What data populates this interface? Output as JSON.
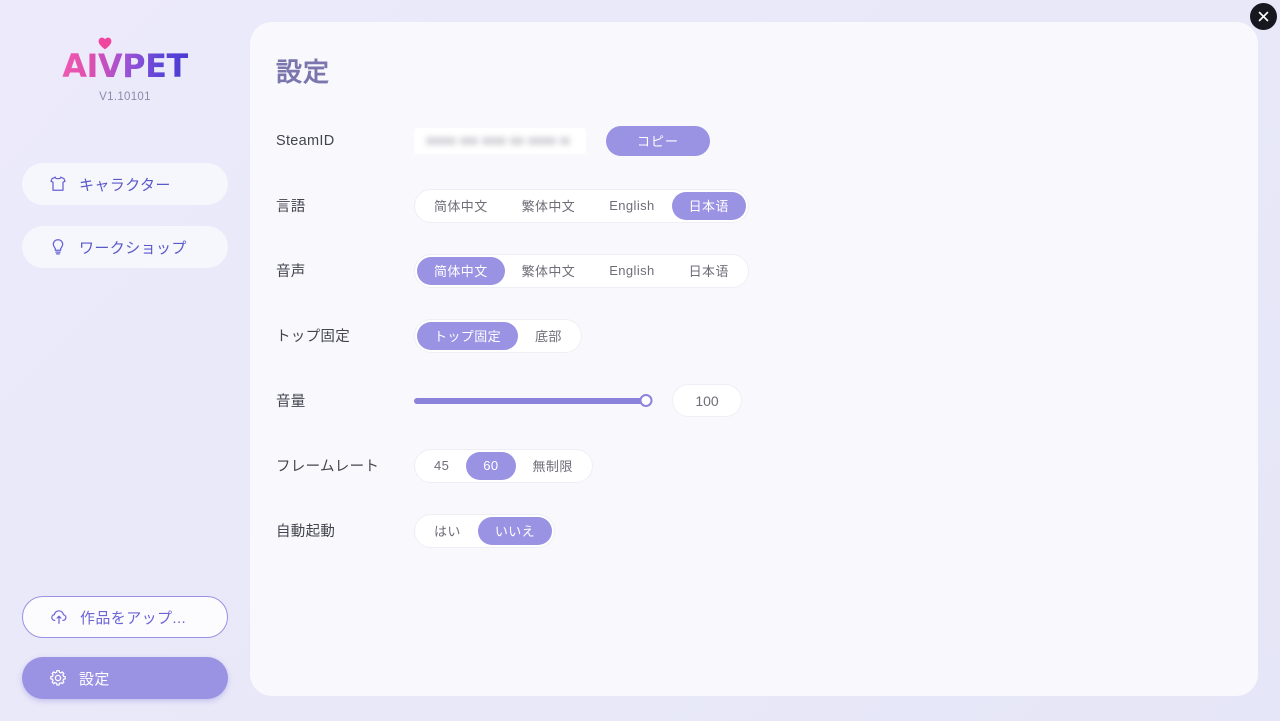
{
  "window": {
    "close_icon": "close-icon"
  },
  "sidebar": {
    "brand": {
      "logo_text": "AIVPET",
      "heart_icon": "heart-icon",
      "version": "V1.10101"
    },
    "items": [
      {
        "label": "キャラクター",
        "icon": "tshirt-icon"
      },
      {
        "label": "ワークショップ",
        "icon": "lightbulb-icon"
      }
    ],
    "bottom": [
      {
        "label": "作品をアップ...",
        "icon": "upload-cloud-icon"
      },
      {
        "label": "設定",
        "icon": "gear-icon"
      }
    ]
  },
  "main": {
    "title": "設定",
    "rows": {
      "steamid": {
        "label": "SteamID",
        "value": "",
        "copy_label": "コピー"
      },
      "language": {
        "label": "言語",
        "options": [
          "简体中文",
          "繁体中文",
          "English",
          "日本语"
        ],
        "selected": "日本语"
      },
      "voice": {
        "label": "音声",
        "options": [
          "简体中文",
          "繁体中文",
          "English",
          "日本语"
        ],
        "selected": "简体中文"
      },
      "pin": {
        "label": "トップ固定",
        "options": [
          "トップ固定",
          "底部"
        ],
        "selected": "トップ固定"
      },
      "volume": {
        "label": "音量",
        "value": "100",
        "percent": 100
      },
      "framerate": {
        "label": "フレームレート",
        "options": [
          "45",
          "60",
          "無制限"
        ],
        "selected": "60"
      },
      "autostart": {
        "label": "自動起動",
        "options": [
          "はい",
          "いいえ"
        ],
        "selected": "いいえ"
      }
    }
  },
  "colors": {
    "accent": "#9a92e3",
    "accent_dark": "#8b82dc",
    "background": "#eaeaf9",
    "panel": "#f9f9fd",
    "nav_text": "#5a59c8",
    "title": "#7b76ae"
  }
}
